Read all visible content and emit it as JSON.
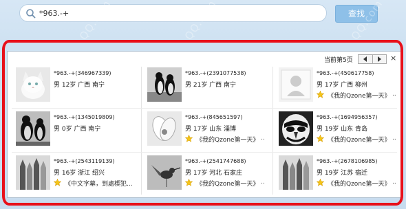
{
  "search": {
    "query": "*963.-+",
    "button_label": "查找"
  },
  "watermark": "QQ.com",
  "panel": {
    "page_label": "当前第5页",
    "close": "×",
    "results": [
      {
        "name": "*963.-+(346967339)",
        "info": "男 12岁 广西 南宁",
        "feed": "",
        "more": "",
        "photo": "cat"
      },
      {
        "name": "*963.-+(2391077538)",
        "info": "男 21岁 广西 南宁",
        "feed": "",
        "more": "",
        "photo": "penguins"
      },
      {
        "name": "*963.-+(450617758)",
        "info": "男 17岁 广西 柳州",
        "feed": "《我的Qzone第一天》",
        "more": "..",
        "photo": "default"
      },
      {
        "name": "*963.-+(1345019809)",
        "info": "男 0岁 广西 南宁",
        "feed": "",
        "more": "",
        "photo": "penguins2"
      },
      {
        "name": "*963.-+(845651597)",
        "info": "男 17岁 山东 淄博",
        "feed": "《我的Qzone第一天》",
        "more": "..",
        "photo": "flower"
      },
      {
        "name": "*963.-+(1694956357)",
        "info": "男 19岁 山东 青岛",
        "feed": "《我的Qzone第一天》",
        "more": "..",
        "photo": "mask"
      },
      {
        "name": "*963.-+(2543119139)",
        "info": "男 16岁 浙江 绍兴",
        "feed": "《中文字幕，到處楔犯...",
        "more": "",
        "photo": "pencils"
      },
      {
        "name": "*963.-+(2541747688)",
        "info": "男 17岁 河北 石家庄",
        "feed": "《我的Qzone第一天》",
        "more": "..",
        "photo": "bird"
      },
      {
        "name": "*963.-+(2678106985)",
        "info": "男 19岁 江苏 宿迁",
        "feed": "《我的Qzone第一天》",
        "more": "..",
        "photo": "pencils"
      }
    ]
  },
  "icons": {
    "search": "search-icon",
    "star": "star-icon",
    "prev": "arrow-left-icon",
    "next": "arrow-right-icon"
  }
}
